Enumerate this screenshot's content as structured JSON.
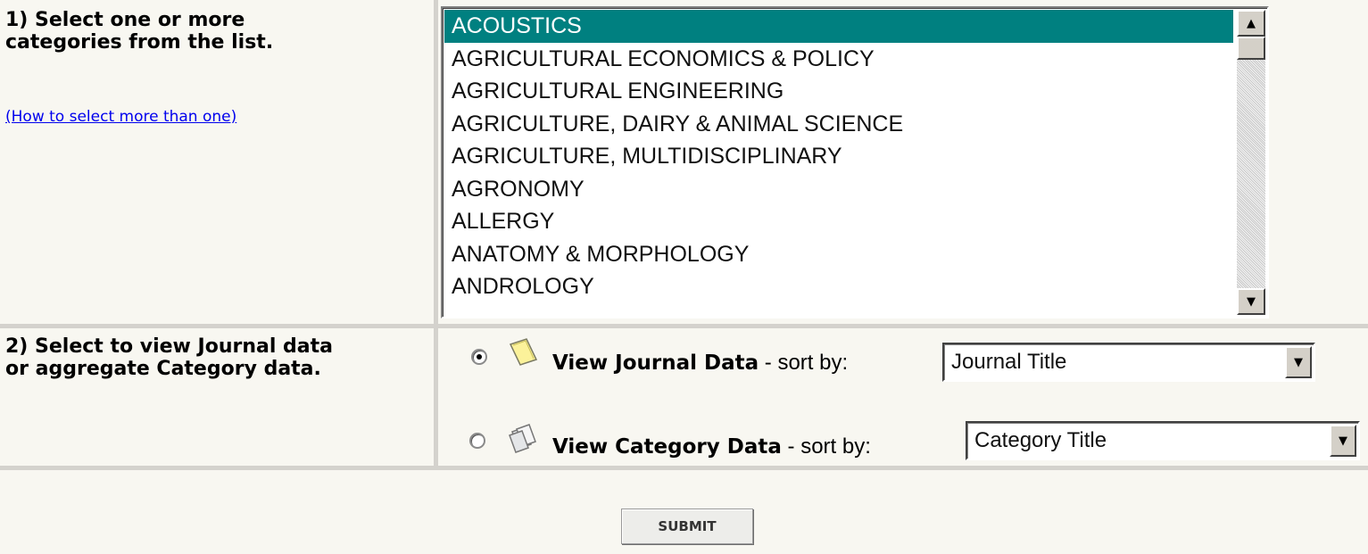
{
  "step1": {
    "line1": "1) Select one or more",
    "line2": "categories from the list.",
    "help_link": "(How to select more than one)"
  },
  "categories": {
    "selected": "ACOUSTICS",
    "items": [
      "ACOUSTICS",
      "AGRICULTURAL ECONOMICS & POLICY",
      "AGRICULTURAL ENGINEERING",
      "AGRICULTURE, DAIRY & ANIMAL SCIENCE",
      "AGRICULTURE, MULTIDISCIPLINARY",
      "AGRONOMY",
      "ALLERGY",
      "ANATOMY & MORPHOLOGY",
      "ANDROLOGY"
    ]
  },
  "step2": {
    "line1": "2) Select to view Journal data",
    "line2": "or aggregate Category data.",
    "journal": {
      "label": "View Journal Data",
      "sort_text": " - sort by: ",
      "sort_value": "Journal Title",
      "checked": true,
      "icon": "journal-icon"
    },
    "category": {
      "label": "View Category Data",
      "sort_text": " - sort by: ",
      "sort_value": "Category Title",
      "checked": false,
      "icon": "category-icon"
    }
  },
  "submit_label": "SUBMIT",
  "colors": {
    "selection": "#008080",
    "panel": "#f8f7f1",
    "grid": "#d4d2cd",
    "link": "#0000ee"
  }
}
